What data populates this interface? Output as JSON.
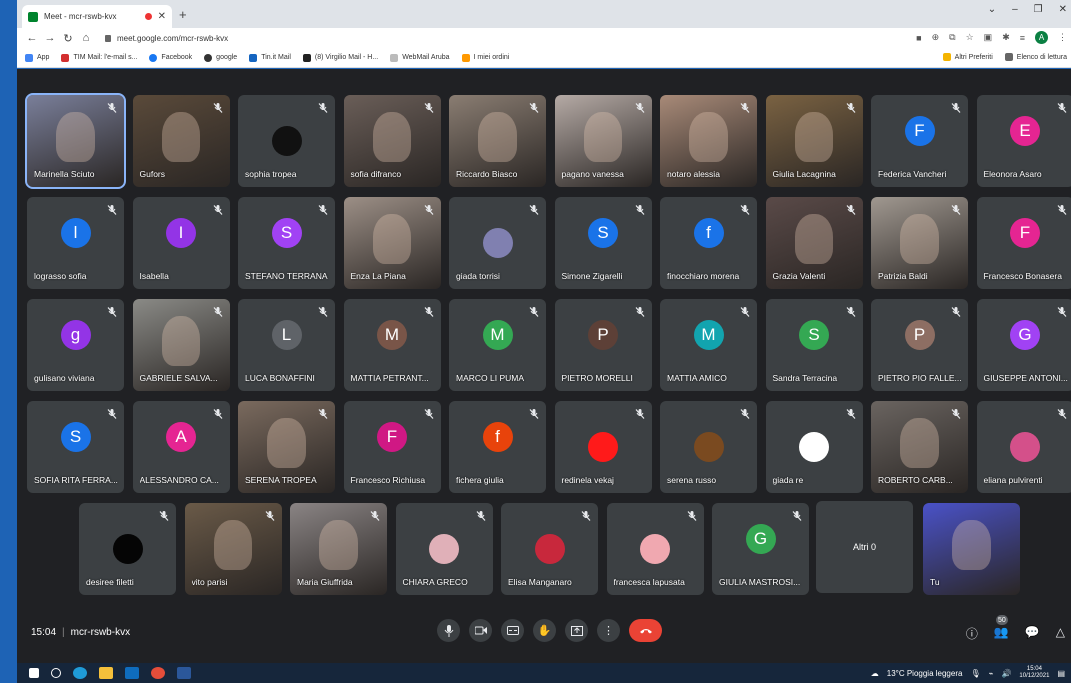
{
  "browser": {
    "tab_title": "Meet - mcr-rswb-kvx",
    "new_tab": "+",
    "url": "meet.google.com/mcr-rswb-kvx",
    "profile_initial": "A",
    "window_controls": [
      "⌄",
      "–",
      "❐",
      "✕"
    ],
    "bookmarks": [
      "App",
      "TIM Mail: l'e-mail s...",
      "Facebook",
      "google",
      "Tin.it Mail",
      "(8) Virgilio Mail - H...",
      "WebMail Aruba",
      "I miei ordini"
    ],
    "bookmarks_right": [
      "Altri Preferiti",
      "Elenco di lettura"
    ]
  },
  "meeting": {
    "time": "15:04",
    "code": "mcr-rswb-kvx",
    "people_count": "50",
    "more_participants": "Altri 0",
    "participants": [
      {
        "name": "Marinella Sciuto",
        "type": "video",
        "color": "#7a7f9a"
      },
      {
        "name": "Gufors",
        "type": "video",
        "color": "#5a4a3a"
      },
      {
        "name": "sophia tropea",
        "type": "dot",
        "color": "#111111"
      },
      {
        "name": "sofia difranco",
        "type": "video",
        "color": "#6a5e58"
      },
      {
        "name": "Riccardo Biasco",
        "type": "video",
        "color": "#8a7d72"
      },
      {
        "name": "pagano vanessa",
        "type": "video",
        "color": "#b5aaa5"
      },
      {
        "name": "notaro alessia",
        "type": "video",
        "color": "#a88a78"
      },
      {
        "name": "Giulia Lacagnina",
        "type": "video",
        "color": "#7a6242"
      },
      {
        "name": "Federica Vancheri",
        "type": "letter",
        "letter": "F",
        "color": "#1a73e8"
      },
      {
        "name": "Eleonora Asaro",
        "type": "letter",
        "letter": "E",
        "color": "#e52592"
      },
      {
        "name": "lograsso sofia",
        "type": "letter",
        "letter": "l",
        "color": "#1a73e8"
      },
      {
        "name": "Isabella",
        "type": "letter",
        "letter": "I",
        "color": "#9334e6"
      },
      {
        "name": "STEFANO TERRANA",
        "type": "letter",
        "letter": "S",
        "color": "#a142f4"
      },
      {
        "name": "Enza La Piana",
        "type": "video",
        "color": "#9c8f86"
      },
      {
        "name": "giada torrisi",
        "type": "dot",
        "color": "#8080b0"
      },
      {
        "name": "Simone Zigarelli",
        "type": "letter",
        "letter": "S",
        "color": "#1a73e8"
      },
      {
        "name": "finocchiaro morena",
        "type": "letter",
        "letter": "f",
        "color": "#1a73e8"
      },
      {
        "name": "Grazia Valenti",
        "type": "video",
        "color": "#5a4a48"
      },
      {
        "name": "Patrizia Baldi",
        "type": "video",
        "color": "#a09890"
      },
      {
        "name": "Francesco Bonasera",
        "type": "letter",
        "letter": "F",
        "color": "#e52592"
      },
      {
        "name": "gulisano viviana",
        "type": "letter",
        "letter": "g",
        "color": "#9334e6"
      },
      {
        "name": "GABRIELE SALVA...",
        "type": "video",
        "color": "#8a8a86"
      },
      {
        "name": "LUCA BONAFFINI",
        "type": "letter",
        "letter": "L",
        "color": "#5f6368"
      },
      {
        "name": "MATTIA PETRANT...",
        "type": "letter",
        "letter": "M",
        "color": "#795548"
      },
      {
        "name": "MARCO LI PUMA",
        "type": "letter",
        "letter": "M",
        "color": "#34a853"
      },
      {
        "name": "PIETRO MORELLI",
        "type": "letter",
        "letter": "P",
        "color": "#5d4037"
      },
      {
        "name": "MATTIA AMICO",
        "type": "letter",
        "letter": "M",
        "color": "#12a4af"
      },
      {
        "name": "Sandra Terracina",
        "type": "letter",
        "letter": "S",
        "color": "#34a853"
      },
      {
        "name": "PIETRO PIO FALLE...",
        "type": "letter",
        "letter": "P",
        "color": "#8d6e63"
      },
      {
        "name": "GIUSEPPE ANTONI...",
        "type": "letter",
        "letter": "G",
        "color": "#a142f4"
      },
      {
        "name": "SOFIA RITA FERRA...",
        "type": "letter",
        "letter": "S",
        "color": "#1a73e8"
      },
      {
        "name": "ALESSANDRO CA...",
        "type": "letter",
        "letter": "A",
        "color": "#e52592"
      },
      {
        "name": "SERENA TROPEA",
        "type": "video",
        "color": "#7a6a5e"
      },
      {
        "name": "Francesco Richiusa",
        "type": "letter",
        "letter": "F",
        "color": "#d01884"
      },
      {
        "name": "fichera giulia",
        "type": "letter",
        "letter": "f",
        "color": "#e8430b"
      },
      {
        "name": "redinela vekaj",
        "type": "dot",
        "color": "#ff1a1a"
      },
      {
        "name": "serena russo",
        "type": "dot",
        "color": "#7a4a20"
      },
      {
        "name": "giada re",
        "type": "dot",
        "color": "#ffffff"
      },
      {
        "name": "ROBERTO CARB...",
        "type": "video",
        "color": "#6a6460"
      },
      {
        "name": "eliana pulvirenti",
        "type": "dot",
        "color": "#d4508a"
      },
      {
        "name": "desiree filetti",
        "type": "dot",
        "color": "#050505"
      },
      {
        "name": "vito parisi",
        "type": "video",
        "color": "#6a5a48"
      },
      {
        "name": "Maria Giuffrida",
        "type": "video",
        "color": "#8a8484"
      },
      {
        "name": "CHIARA GRECO",
        "type": "dot",
        "color": "#e0b0b8"
      },
      {
        "name": "Elisa Manganaro",
        "type": "dot",
        "color": "#c8283c"
      },
      {
        "name": "francesca lapusata",
        "type": "dot",
        "color": "#f0a8b0"
      },
      {
        "name": "GIULIA MASTROSI...",
        "type": "letter",
        "letter": "G",
        "color": "#34a853"
      },
      {
        "name": "Tu",
        "type": "video",
        "color": "#4a52c8"
      }
    ]
  },
  "taskbar": {
    "weather": "13°C  Pioggia leggera",
    "time": "15:04",
    "date": "10/12/2021"
  }
}
